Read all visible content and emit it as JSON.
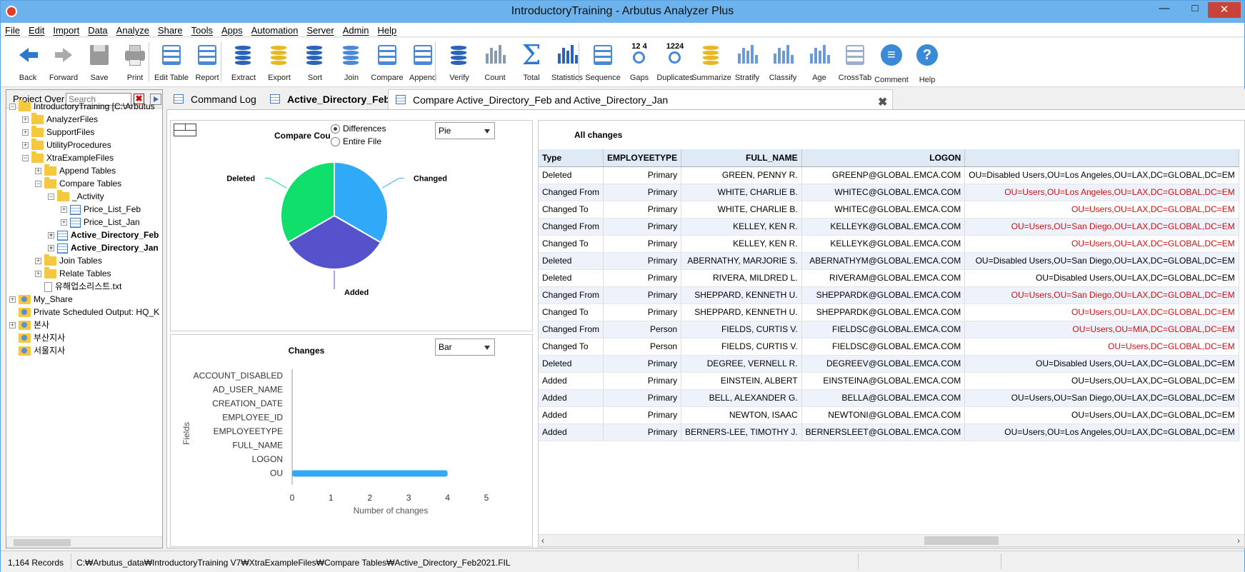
{
  "window": {
    "title": "IntroductoryTraining - Arbutus Analyzer Plus",
    "minimize_glyph": "□",
    "maximize_glyph": "□",
    "close_glyph": "✕"
  },
  "menu": [
    "File",
    "Edit",
    "Import",
    "Data",
    "Analyze",
    "Share",
    "Tools",
    "Apps",
    "Automation",
    "Server",
    "Admin",
    "Help"
  ],
  "toolbar": [
    {
      "label": "Back",
      "icon": "back-arrow-icon",
      "color": "#2a78d0"
    },
    {
      "label": "Forward",
      "icon": "forward-arrow-icon",
      "color": "#aaaaaa"
    },
    {
      "label": "Save",
      "icon": "save-icon",
      "color": "#999999"
    },
    {
      "label": "Print",
      "icon": "print-icon",
      "color": "#999999"
    },
    {
      "label": "Edit Table",
      "icon": "edit-table-icon",
      "color": "#4a88d8"
    },
    {
      "label": "Report",
      "icon": "report-icon",
      "color": "#4a88d8"
    },
    {
      "label": "Extract",
      "icon": "extract-icon",
      "color": "#2a64b8"
    },
    {
      "label": "Export",
      "icon": "export-icon",
      "color": "#e8b820"
    },
    {
      "label": "Sort",
      "icon": "sort-icon",
      "color": "#2a64b8"
    },
    {
      "label": "Join",
      "icon": "join-icon",
      "color": "#4a88d8"
    },
    {
      "label": "Compare",
      "icon": "compare-icon",
      "color": "#4a88d8"
    },
    {
      "label": "Append",
      "icon": "append-icon",
      "color": "#4a88d8"
    },
    {
      "label": "Verify",
      "icon": "verify-icon",
      "color": "#2a64b8"
    },
    {
      "label": "Count",
      "icon": "count-icon",
      "color": "#8a9aae"
    },
    {
      "label": "Total",
      "icon": "total-sigma-icon",
      "color": "#2a78d0"
    },
    {
      "label": "Statistics",
      "icon": "statistics-icon",
      "color": "#2a64b8"
    },
    {
      "label": "Sequence",
      "icon": "sequence-icon",
      "color": "#4a88d8"
    },
    {
      "label": "Gaps",
      "icon": "gaps-icon",
      "color": "#4a88d8",
      "text": "12  4"
    },
    {
      "label": "Duplicates",
      "icon": "duplicates-icon",
      "color": "#4a88d8",
      "text": "1224"
    },
    {
      "label": "Summarize",
      "icon": "summarize-icon",
      "color": "#e8b820"
    },
    {
      "label": "Stratify",
      "icon": "stratify-icon",
      "color": "#6a9ad8"
    },
    {
      "label": "Classify",
      "icon": "classify-icon",
      "color": "#6a9ad8"
    },
    {
      "label": "Age",
      "icon": "age-icon",
      "color": "#6a9ad8"
    },
    {
      "label": "CrossTab",
      "icon": "crosstab-icon",
      "color": "#9aaed0"
    },
    {
      "label": "Comment",
      "icon": "comment-icon",
      "color": "#3a8ad8"
    },
    {
      "label": "Help",
      "icon": "help-icon",
      "color": "#3a8ad8"
    }
  ],
  "project": {
    "label": "Project Over",
    "search_placeholder": "Search",
    "clear_glyph": "✖",
    "tree": [
      {
        "label": "IntroductoryTraining [C:\\Arbutus",
        "icon": "folder",
        "pm": "−",
        "bold": false
      },
      {
        "label": "AnalyzerFiles",
        "icon": "folder",
        "pm": "+",
        "bold": false
      },
      {
        "label": "SupportFiles",
        "icon": "folder",
        "pm": "+",
        "bold": false
      },
      {
        "label": "UtilityProcedures",
        "icon": "folder",
        "pm": "+",
        "bold": false
      },
      {
        "label": "XtraExampleFiles",
        "icon": "folder",
        "pm": "−",
        "bold": false
      },
      {
        "label": "Append Tables",
        "icon": "folder",
        "pm": "+",
        "bold": false
      },
      {
        "label": "Compare Tables",
        "icon": "folder",
        "pm": "−",
        "bold": false
      },
      {
        "label": "_Activity",
        "icon": "folder",
        "pm": "−",
        "bold": false
      },
      {
        "label": "Price_List_Feb",
        "icon": "table",
        "pm": "+",
        "bold": false
      },
      {
        "label": "Price_List_Jan",
        "icon": "table",
        "pm": "+",
        "bold": false
      },
      {
        "label": "Active_Directory_Feb",
        "icon": "table",
        "pm": "+",
        "bold": true
      },
      {
        "label": "Active_Directory_Jan",
        "icon": "table",
        "pm": "+",
        "bold": true
      },
      {
        "label": "Join Tables",
        "icon": "folder",
        "pm": "+",
        "bold": false
      },
      {
        "label": "Relate Tables",
        "icon": "folder",
        "pm": "+",
        "bold": false
      },
      {
        "label": "유해업소리스트.txt",
        "icon": "text",
        "pm": "",
        "bold": false
      },
      {
        "label": "My_Share",
        "icon": "share",
        "pm": "+",
        "bold": false
      },
      {
        "label": "Private Scheduled Output:  HQ_K",
        "icon": "share",
        "pm": "",
        "bold": false
      },
      {
        "label": "본사",
        "icon": "share",
        "pm": "+",
        "bold": false
      },
      {
        "label": "부산지사",
        "icon": "share",
        "pm": "",
        "bold": false
      },
      {
        "label": "서울지사",
        "icon": "share",
        "pm": "",
        "bold": false
      }
    ]
  },
  "tabs": [
    {
      "label": "Command Log"
    },
    {
      "label": "Active_Directory_Feb"
    },
    {
      "label": "Compare Active_Directory_Feb and Active_Directory_Jan"
    }
  ],
  "tab_close_glyph": "✖",
  "pie_panel": {
    "select": "Pie",
    "radio_differences": "Differences",
    "radio_entire": "Entire File",
    "title": "Compare Cou"
  },
  "bar_panel": {
    "select": "Bar"
  },
  "chart_data": [
    {
      "type": "pie",
      "title": "Compare Cou",
      "labels": [
        "Changed",
        "Added",
        "Deleted"
      ],
      "values": [
        5,
        5,
        5
      ],
      "colors": [
        "#30aaf8",
        "#5552cc",
        "#10df6c"
      ]
    },
    {
      "type": "bar",
      "title": "Changes",
      "xlabel": "Number of changes",
      "ylabel": "Fields",
      "categories": [
        "ACCOUNT_DISABLED",
        "AD_USER_NAME",
        "CREATION_DATE",
        "EMPLOYEE_ID",
        "EMPLOYEETYPE",
        "FULL_NAME",
        "LOGON",
        "OU"
      ],
      "values": [
        0,
        0,
        0,
        0,
        0,
        0,
        0,
        4
      ],
      "xlim": [
        0,
        5
      ],
      "xticks": [
        "0",
        "1",
        "2",
        "3",
        "4",
        "5"
      ],
      "color": "#30aaf8"
    }
  ],
  "grid": {
    "title": "All changes",
    "columns": [
      "Type",
      "EMPLOYEETYPE",
      "FULL_NAME",
      "LOGON",
      ""
    ],
    "rows": [
      [
        "Deleted",
        "Primary",
        "GREEN, PENNY R.",
        "GREENP@GLOBAL.EMCA.COM",
        "OU=Disabled Users,OU=Los Angeles,OU=LAX,DC=GLOBAL,DC=EM",
        false
      ],
      [
        "Changed From",
        "Primary",
        "WHITE, CHARLIE B.",
        "WHITEC@GLOBAL.EMCA.COM",
        "OU=Users,OU=Los Angeles,OU=LAX,DC=GLOBAL,DC=EM",
        true
      ],
      [
        "Changed To",
        "Primary",
        "WHITE, CHARLIE B.",
        "WHITEC@GLOBAL.EMCA.COM",
        "OU=Users,OU=LAX,DC=GLOBAL,DC=EM",
        true
      ],
      [
        "Changed From",
        "Primary",
        "KELLEY, KEN R.",
        "KELLEYK@GLOBAL.EMCA.COM",
        "OU=Users,OU=San Diego,OU=LAX,DC=GLOBAL,DC=EM",
        true
      ],
      [
        "Changed To",
        "Primary",
        "KELLEY, KEN R.",
        "KELLEYK@GLOBAL.EMCA.COM",
        "OU=Users,OU=LAX,DC=GLOBAL,DC=EM",
        true
      ],
      [
        "Deleted",
        "Primary",
        "ABERNATHY, MARJORIE S.",
        "ABERNATHYM@GLOBAL.EMCA.COM",
        "OU=Disabled Users,OU=San Diego,OU=LAX,DC=GLOBAL,DC=EM",
        false
      ],
      [
        "Deleted",
        "Primary",
        "RIVERA, MILDRED L.",
        "RIVERAM@GLOBAL.EMCA.COM",
        "OU=Disabled Users,OU=LAX,DC=GLOBAL,DC=EM",
        false
      ],
      [
        "Changed From",
        "Primary",
        "SHEPPARD, KENNETH U.",
        "SHEPPARDK@GLOBAL.EMCA.COM",
        "OU=Users,OU=San Diego,OU=LAX,DC=GLOBAL,DC=EM",
        true
      ],
      [
        "Changed To",
        "Primary",
        "SHEPPARD, KENNETH U.",
        "SHEPPARDK@GLOBAL.EMCA.COM",
        "OU=Users,OU=LAX,DC=GLOBAL,DC=EM",
        true
      ],
      [
        "Changed From",
        "Person",
        "FIELDS, CURTIS V.",
        "FIELDSC@GLOBAL.EMCA.COM",
        "OU=Users,OU=MIA,DC=GLOBAL,DC=EM",
        true
      ],
      [
        "Changed To",
        "Person",
        "FIELDS, CURTIS V.",
        "FIELDSC@GLOBAL.EMCA.COM",
        "OU=Users,DC=GLOBAL,DC=EM",
        true
      ],
      [
        "Deleted",
        "Primary",
        "DEGREE, VERNELL R.",
        "DEGREEV@GLOBAL.EMCA.COM",
        "OU=Disabled Users,OU=LAX,DC=GLOBAL,DC=EM",
        false
      ],
      [
        "Added",
        "Primary",
        "EINSTEIN, ALBERT",
        "EINSTEINA@GLOBAL.EMCA.COM",
        "OU=Users,OU=LAX,DC=GLOBAL,DC=EM",
        false
      ],
      [
        "Added",
        "Primary",
        "BELL, ALEXANDER G.",
        "BELLA@GLOBAL.EMCA.COM",
        "OU=Users,OU=San Diego,OU=LAX,DC=GLOBAL,DC=EM",
        false
      ],
      [
        "Added",
        "Primary",
        "NEWTON, ISAAC",
        "NEWTONI@GLOBAL.EMCA.COM",
        "OU=Users,OU=LAX,DC=GLOBAL,DC=EM",
        false
      ],
      [
        "Added",
        "Primary",
        "BERNERS-LEE, TIMOTHY J.",
        "BERNERSLEET@GLOBAL.EMCA.COM",
        "OU=Users,OU=Los Angeles,OU=LAX,DC=GLOBAL,DC=EM",
        false
      ]
    ]
  },
  "status": {
    "records": "1,164 Records",
    "path": "C:₩Arbutus_data₩IntroductoryTraining V7₩XtraExampleFiles₩Compare Tables₩Active_Directory_Feb2021.FIL"
  }
}
